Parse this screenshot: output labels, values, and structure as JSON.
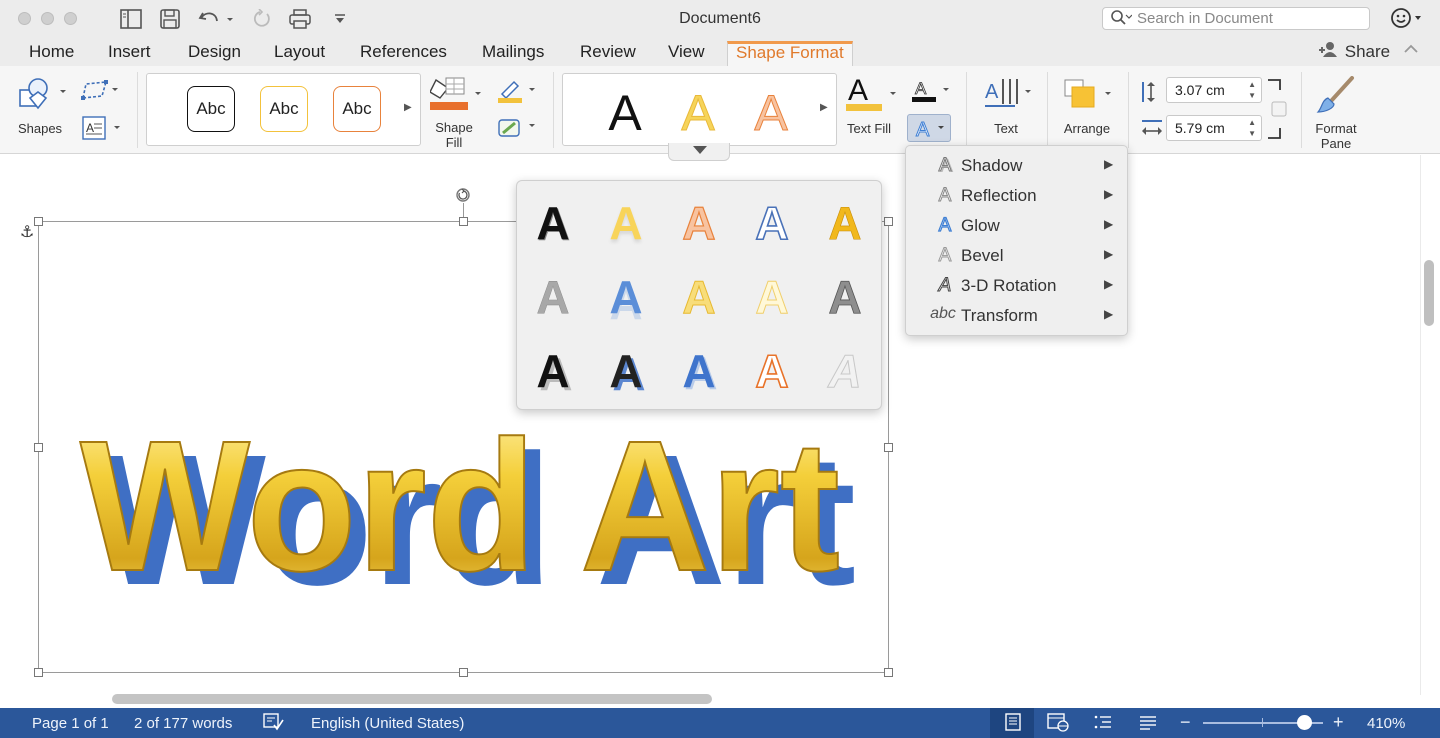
{
  "window": {
    "title": "Document6"
  },
  "search": {
    "placeholder": "Search in Document"
  },
  "tabs": [
    {
      "label": "Home",
      "active": false
    },
    {
      "label": "Insert",
      "active": false
    },
    {
      "label": "Design",
      "active": false
    },
    {
      "label": "Layout",
      "active": false
    },
    {
      "label": "References",
      "active": false
    },
    {
      "label": "Mailings",
      "active": false
    },
    {
      "label": "Review",
      "active": false
    },
    {
      "label": "View",
      "active": false
    },
    {
      "label": "Shape Format",
      "active": true
    }
  ],
  "share": {
    "label": "Share"
  },
  "ribbon": {
    "shapes_label": "Shapes",
    "shape_styles": [
      "Abc",
      "Abc",
      "Abc"
    ],
    "shape_fill_label": "Shape\nFill",
    "wordart_styles": [
      "A",
      "A",
      "A"
    ],
    "text_fill_label": "Text Fill",
    "text_label": "Text",
    "arrange_label": "Arrange",
    "height_value": "3.07 cm",
    "width_value": "5.79 cm",
    "format_pane_label": "Format\nPane"
  },
  "document": {
    "wordart_text": "Word Art"
  },
  "effects_gallery": {
    "glyph": "A"
  },
  "effects_menu": {
    "items": [
      {
        "label": "Shadow",
        "icon": "A"
      },
      {
        "label": "Reflection",
        "icon": "A"
      },
      {
        "label": "Glow",
        "icon": "A"
      },
      {
        "label": "Bevel",
        "icon": "A"
      },
      {
        "label": "3-D Rotation",
        "icon": "A"
      },
      {
        "label": "Transform",
        "icon": "abc"
      }
    ]
  },
  "status": {
    "page": "Page 1 of 1",
    "words": "2 of 177 words",
    "language": "English (United States)",
    "zoom": "410%",
    "zoom_minus": "−",
    "zoom_plus": "+"
  },
  "colors": {
    "accent_tab": "#e07a2c",
    "status_bar": "#2b579a",
    "wordart_gold": "#f2cd3b",
    "wordart_shadow": "#3f6fc4"
  }
}
